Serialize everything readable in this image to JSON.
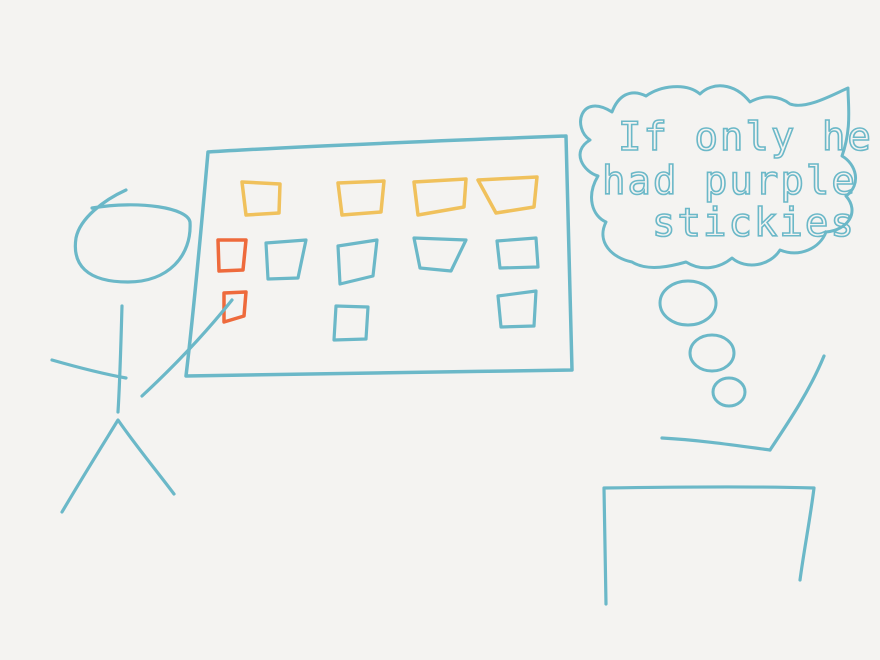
{
  "colors": {
    "background": "#f4f3f1",
    "ink_blue": "#6bb8c8",
    "sticky_yellow": "#f0c15c",
    "sticky_orange": "#ee6a3c"
  },
  "thought_bubble": {
    "lines": [
      "If only he",
      "had purple",
      "stickies"
    ]
  },
  "board": {
    "sticky_rows": [
      [
        "yellow",
        "yellow",
        "yellow",
        "yellow"
      ],
      [
        "orange",
        "blue",
        "blue",
        "blue",
        "blue"
      ],
      [
        "orange",
        "blue",
        "blue"
      ]
    ]
  }
}
